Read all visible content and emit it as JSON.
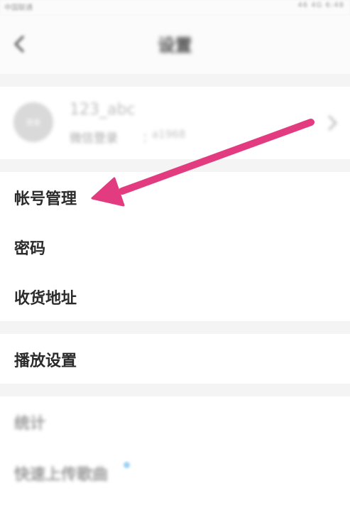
{
  "status_bar": {
    "left_text": "中国联通",
    "right_text": "46 4G 6:48"
  },
  "header": {
    "title": "设置"
  },
  "profile": {
    "avatar_label": "登录",
    "username": "123_abc",
    "login_type": "微信登录",
    "separator": "：",
    "login_id": "a1968"
  },
  "groups": [
    {
      "items": [
        {
          "label": "帐号管理"
        },
        {
          "label": "密码"
        },
        {
          "label": "收货地址"
        }
      ]
    },
    {
      "items": [
        {
          "label": "播放设置"
        }
      ]
    },
    {
      "items": [
        {
          "label": "统计"
        },
        {
          "label": "快速上传歌曲"
        }
      ]
    }
  ],
  "annotation": {
    "arrow_color": "#e33b7f",
    "arrow_target": "帐号管理"
  },
  "colors": {
    "background": "#f4f4f4",
    "card": "#ffffff",
    "text_primary": "#2b2b2b"
  }
}
